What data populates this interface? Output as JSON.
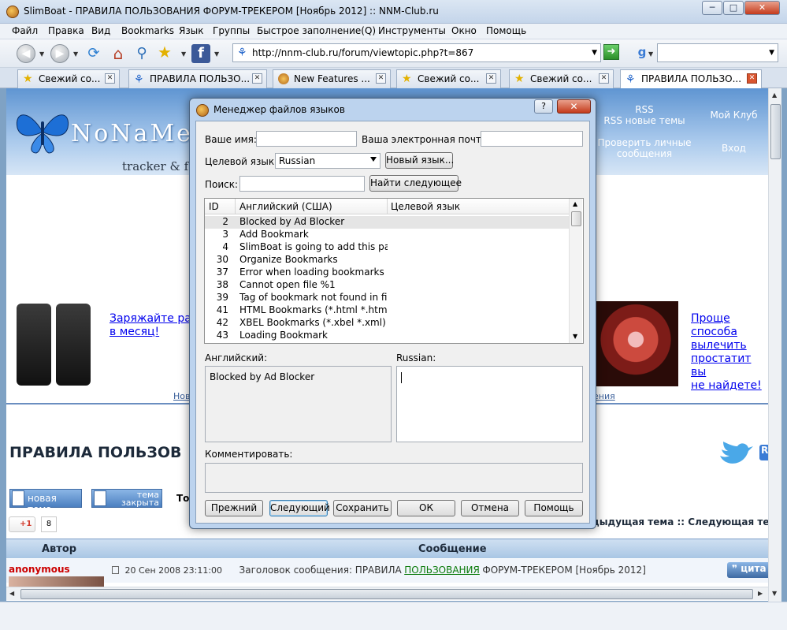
{
  "window": {
    "title": "SlimBoat - ПРАВИЛА ПОЛЬЗОВАНИЯ ФОРУМ-ТРЕКЕРОМ [Ноябрь 2012] :: NNM-Club.ru",
    "minimize": "─",
    "maximize": "□",
    "close": "✕"
  },
  "menu": [
    "Файл",
    "Правка",
    "Вид",
    "Bookmarks",
    "Язык",
    "Группы",
    "Быстрое заполнение(Q)",
    "Инструменты",
    "Окно",
    "Помощь"
  ],
  "toolbar": {
    "url": "http://nnm-club.ru/forum/viewtopic.php?t=867"
  },
  "tabs": [
    {
      "label": "Свежий со...",
      "icon": "star-icon"
    },
    {
      "label": "ПРАВИЛА ПОЛЬЗО...",
      "icon": "butterfly-icon"
    },
    {
      "label": "New Features ...",
      "icon": "globe-icon"
    },
    {
      "label": "Свежий со...",
      "icon": "star-icon"
    },
    {
      "label": "Свежий со...",
      "icon": "star-icon"
    },
    {
      "label": "ПРАВИЛА ПОЛЬЗО...",
      "icon": "butterfly-icon",
      "active": true
    }
  ],
  "site": {
    "logo": "NoNaMe C",
    "tracker": "tracker & f",
    "nav": {
      "rss": "RSS",
      "rss_new": "RSS новые темы",
      "my_club": "Мой Клуб",
      "check_messages_1": "Проверить личные",
      "check_messages_2": "сообщения",
      "login": "Вход"
    },
    "ad_left_1": "Заряжайте раз",
    "ad_left_2": "в месяц!",
    "ad_right_1": "Проще способа",
    "ad_right_2": "вылечить",
    "ad_right_3": "простатит вы",
    "ad_right_4": "не найдете!",
    "link_left": "Нов",
    "link_right": "ения",
    "page_title": "ПРАВИЛА ПОЛЬЗОВ",
    "new_topic": "новая тема",
    "topic_closed_1": "тема",
    "topic_closed_2": "закрыта",
    "topic_prefix": "То",
    "gplus": "+1",
    "gplus_count": "8",
    "prev_next": "дыдущая тема :: Следующая те",
    "col_author": "Автор",
    "col_message": "Сообщение",
    "author": "anonymous",
    "post_date": "20 Сен 2008 23:11:00",
    "post_subject_prefix": "Заголовок сообщения: ПРАВИЛА",
    "post_subject_link": "ПОЛЬЗОВАНИЯ",
    "post_subject_suffix": "ФОРУМ-ТРЕКЕРОМ [Ноябрь 2012]",
    "quote": "цита"
  },
  "dialog": {
    "title": "Менеджер файлов языков",
    "help": "?",
    "close": "✕",
    "name_label": "Ваше имя:",
    "email_label": "Ваша электронная почта:",
    "target_label": "Целевой язык:",
    "target_value": "Russian",
    "new_language": "Новый язык...",
    "search_label": "Поиск:",
    "find_next": "Найти следующее",
    "columns": {
      "id": "ID",
      "english": "Английский (США)",
      "target": "Целевой язык"
    },
    "rows": [
      {
        "id": "2",
        "english": "Blocked by Ad Blocker"
      },
      {
        "id": "3",
        "english": "Add Bookmark"
      },
      {
        "id": "4",
        "english": "SlimBoat is going to add this pa..."
      },
      {
        "id": "30",
        "english": "Organize Bookmarks"
      },
      {
        "id": "37",
        "english": "Error when loading bookmarks ..."
      },
      {
        "id": "38",
        "english": "Cannot open file %1"
      },
      {
        "id": "39",
        "english": "Tag of bookmark not found in fi..."
      },
      {
        "id": "41",
        "english": "HTML Bookmarks (*.html *.htm)"
      },
      {
        "id": "42",
        "english": "XBEL Bookmarks (*.xbel *.xml)"
      },
      {
        "id": "43",
        "english": "Loading Bookmark"
      }
    ],
    "english_label": "Английский:",
    "english_text": "Blocked by Ad Blocker",
    "russian_label": "Russian:",
    "comment_label": "Комментировать:",
    "buttons": {
      "prev": "Прежний",
      "next": "Следующий",
      "save": "Сохранить",
      "ok": "ОК",
      "cancel": "Отмена",
      "help": "Помощь"
    }
  }
}
